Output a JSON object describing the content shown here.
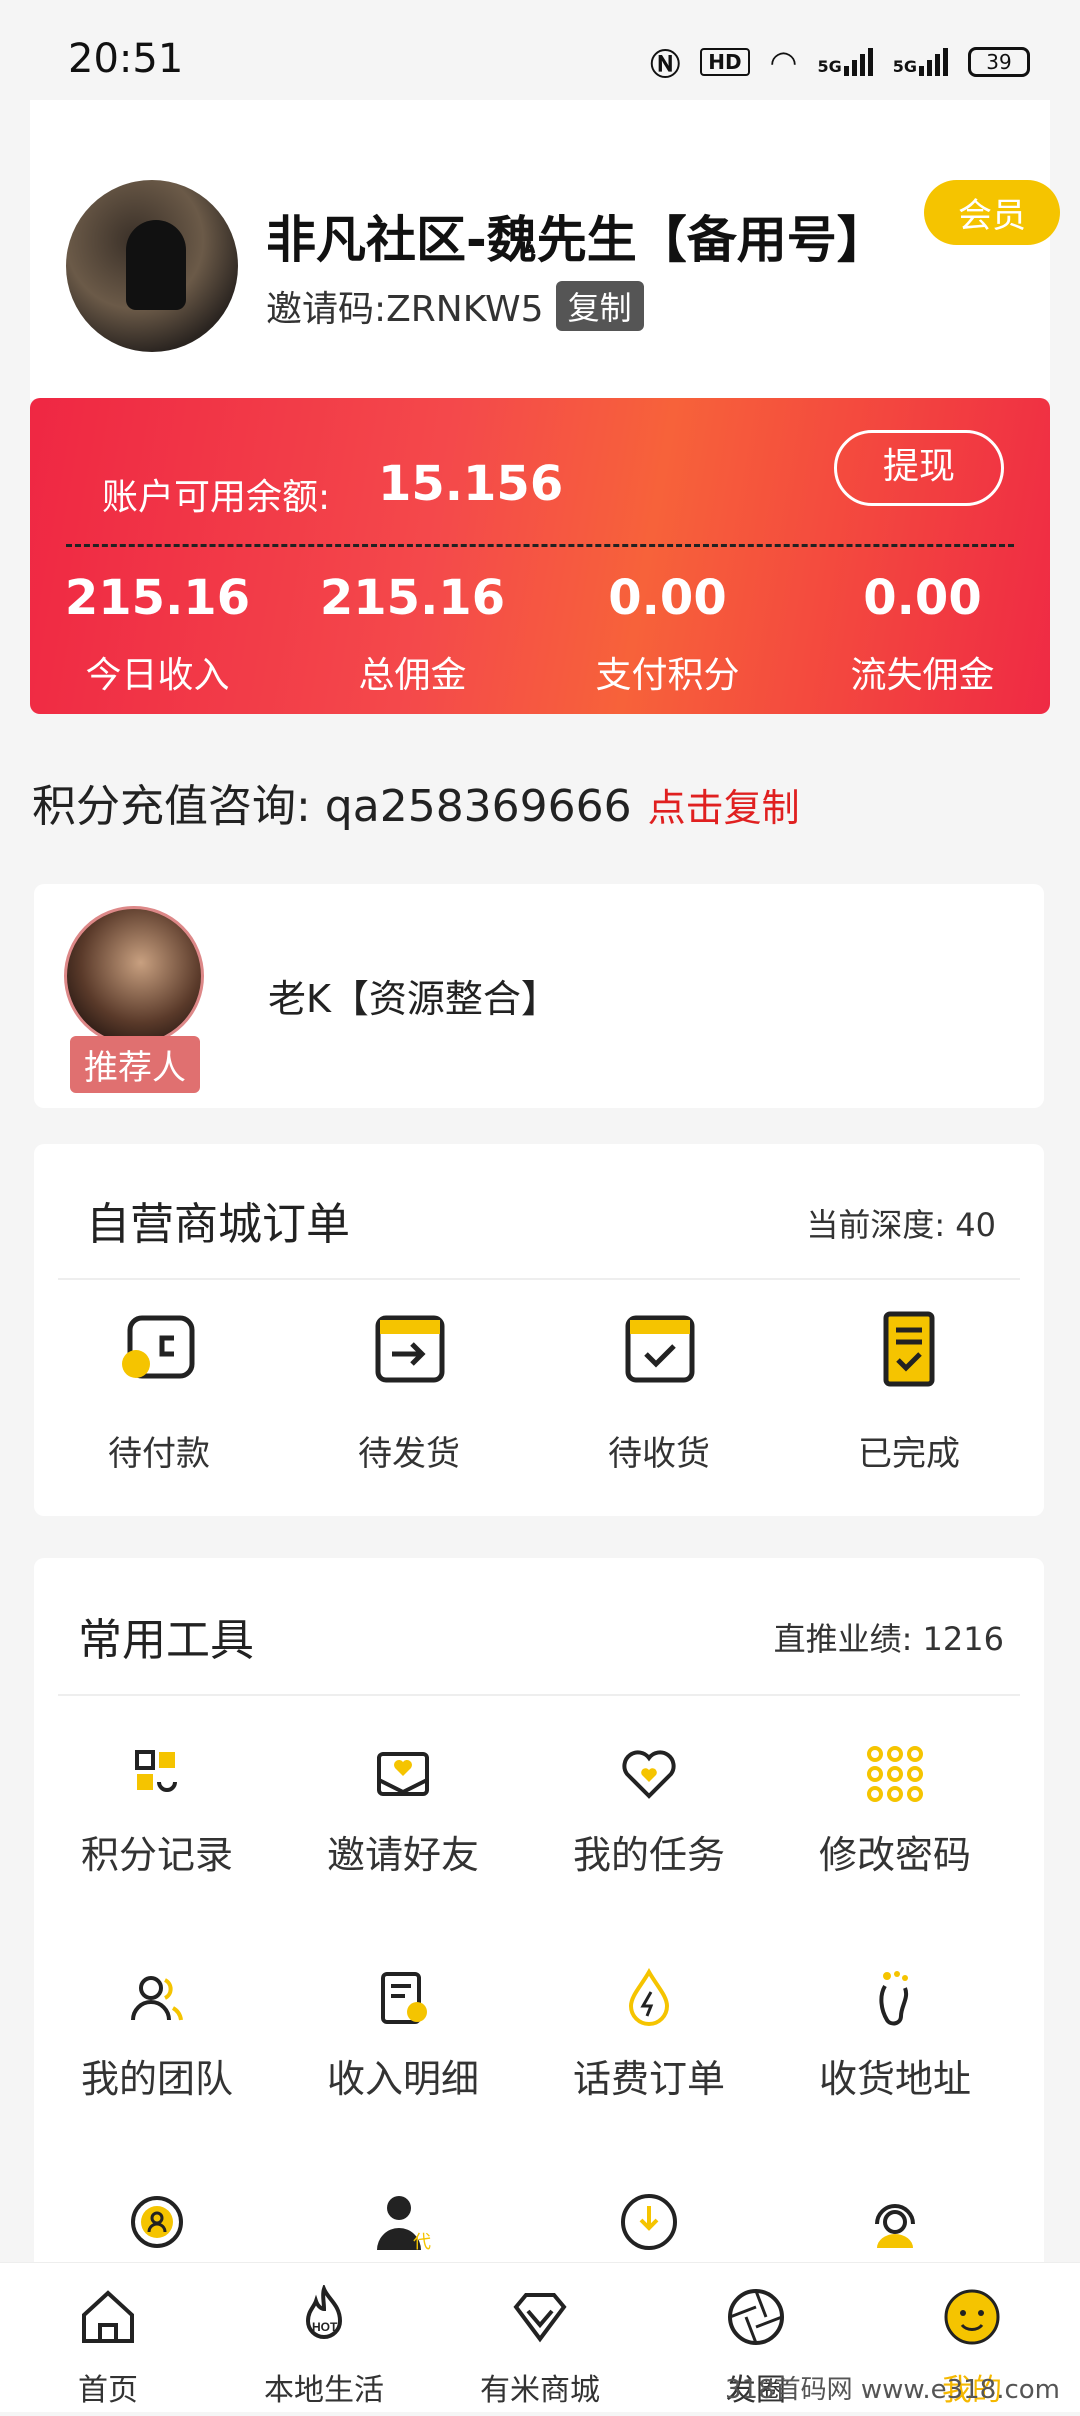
{
  "status_bar": {
    "time": "20:51",
    "battery": "39",
    "hd": "HD",
    "net1": "5G",
    "net2": "5G"
  },
  "profile": {
    "name": "非凡社区-魏先生【备用号】",
    "invite_label": "邀请码:ZRNKW5",
    "copy_label": "复制",
    "member_badge": "会员"
  },
  "balance": {
    "label": "账户可用余额:",
    "value": "15.156",
    "withdraw_label": "提现",
    "stats": [
      {
        "value": "215.16",
        "label": "今日收入"
      },
      {
        "value": "215.16",
        "label": "总佣金"
      },
      {
        "value": "0.00",
        "label": "支付积分"
      },
      {
        "value": "0.00",
        "label": "流失佣金"
      }
    ]
  },
  "consult": {
    "text": "积分充值咨询:  qa258369666",
    "copy_label": "点击复制"
  },
  "referrer": {
    "tag": "推荐人",
    "name": "老K【资源整合】"
  },
  "orders": {
    "title": "自营商城订单",
    "depth": "当前深度:  40",
    "items": [
      {
        "label": "待付款",
        "icon": "wallet-icon"
      },
      {
        "label": "待发货",
        "icon": "box-arrow-icon"
      },
      {
        "label": "待收货",
        "icon": "box-check-icon"
      },
      {
        "label": "已完成",
        "icon": "clipboard-check-icon"
      }
    ]
  },
  "tools": {
    "title": "常用工具",
    "performance": "直推业绩:  1216",
    "items": [
      {
        "label": "积分记录",
        "icon": "points-record-icon"
      },
      {
        "label": "邀请好友",
        "icon": "invite-envelope-icon"
      },
      {
        "label": "我的任务",
        "icon": "heart-task-icon"
      },
      {
        "label": "修改密码",
        "icon": "keypad-icon"
      },
      {
        "label": "我的团队",
        "icon": "team-icon"
      },
      {
        "label": "收入明细",
        "icon": "income-doc-icon"
      },
      {
        "label": "话费订单",
        "icon": "drop-bolt-icon"
      },
      {
        "label": "收货地址",
        "icon": "footprint-icon"
      },
      {
        "label": "",
        "icon": "user-circle-icon"
      },
      {
        "label": "",
        "icon": "agent-icon"
      },
      {
        "label": "",
        "icon": "download-circle-icon"
      },
      {
        "label": "",
        "icon": "headset-icon"
      }
    ]
  },
  "tabbar": [
    {
      "label": "首页",
      "icon": "home-icon"
    },
    {
      "label": "本地生活",
      "icon": "hot-icon"
    },
    {
      "label": "有米商城",
      "icon": "diamond-icon"
    },
    {
      "label": "发圈",
      "icon": "aperture-icon"
    },
    {
      "label": "我的",
      "icon": "smiley-icon"
    }
  ],
  "watermark": "318首码网  www.e318.com",
  "colors": {
    "accent": "#f5c400",
    "red": "#ef2743",
    "link_red": "#e02020"
  }
}
